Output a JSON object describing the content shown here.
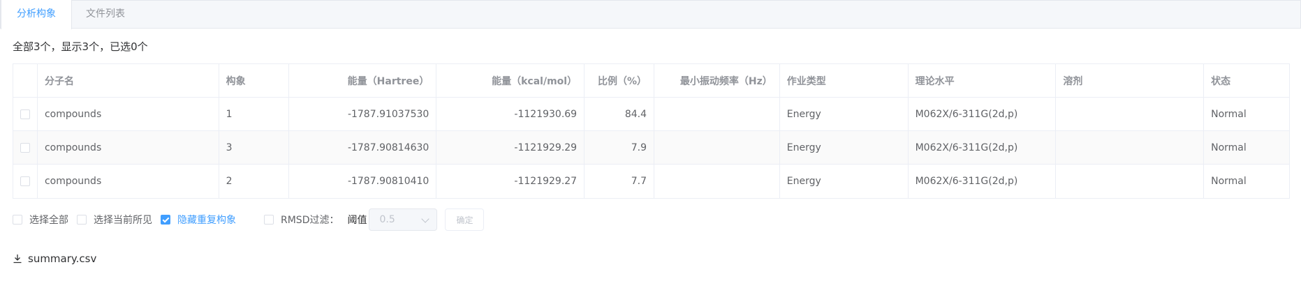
{
  "tabs": [
    {
      "label": "分析构象",
      "active": true
    },
    {
      "label": "文件列表",
      "active": false
    }
  ],
  "summary_text": "全部3个，显示3个，已选0个",
  "table": {
    "headers": [
      "分子名",
      "构象",
      "能量（Hartree）",
      "能量（kcal/mol）",
      "比例（%）",
      "最小振动频率（Hz）",
      "作业类型",
      "理论水平",
      "溶剂",
      "状态"
    ],
    "rows": [
      {
        "name": "compounds",
        "conformer": "1",
        "hartree": "-1787.91037530",
        "kcal": "-1121930.69",
        "ratio": "84.4",
        "min_freq": "",
        "job_type": "Energy",
        "theory": "M062X/6-311G(2d,p)",
        "solvent": "",
        "status": "Normal"
      },
      {
        "name": "compounds",
        "conformer": "3",
        "hartree": "-1787.90814630",
        "kcal": "-1121929.29",
        "ratio": "7.9",
        "min_freq": "",
        "job_type": "Energy",
        "theory": "M062X/6-311G(2d,p)",
        "solvent": "",
        "status": "Normal"
      },
      {
        "name": "compounds",
        "conformer": "2",
        "hartree": "-1787.90810410",
        "kcal": "-1121929.27",
        "ratio": "7.7",
        "min_freq": "",
        "job_type": "Energy",
        "theory": "M062X/6-311G(2d,p)",
        "solvent": "",
        "status": "Normal"
      }
    ]
  },
  "controls": {
    "select_all": "选择全部",
    "select_visible": "选择当前所见",
    "hide_duplicates": "隐藏重复构象",
    "hide_duplicates_checked": true,
    "rmsd_filter": "RMSD过滤：",
    "threshold_label": "阈值",
    "threshold_value": "0.5",
    "confirm": "确定"
  },
  "download": {
    "label": "summary.csv",
    "icon": "download-icon"
  },
  "colors": {
    "accent": "#409eff",
    "border": "#ebeef5",
    "muted": "#909399"
  }
}
